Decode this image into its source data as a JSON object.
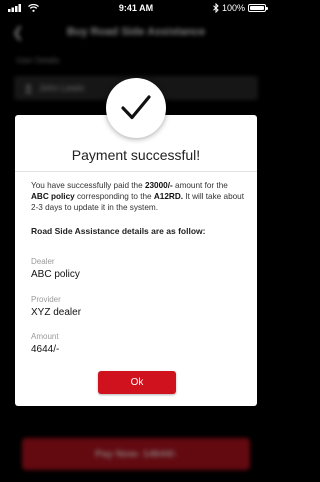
{
  "status_bar": {
    "time": "9:41 AM",
    "battery": "100%",
    "battery_level": 1.0
  },
  "background": {
    "nav_title": "Buy Road Side Assistance",
    "section_label": "User Details",
    "user_name": "John Lewis",
    "pay_button_label": "Pay Now- 14644/-"
  },
  "modal": {
    "title": "Payment successful!",
    "message": {
      "part1": "You have successfully paid the ",
      "amount": "23000/-",
      "part2": " amount for the ",
      "policy": "ABC policy",
      "part3": " corresponding to the ",
      "vehicle": "A12RD.",
      "part4": " It will take about 2-3 days to update it in the system."
    },
    "details_heading": "Road Side Assistance details are as follow:",
    "fields": [
      {
        "label": "Dealer",
        "value": "ABC policy"
      },
      {
        "label": "Provider",
        "value": "XYZ dealer"
      },
      {
        "label": "Amount",
        "value": "4644/-"
      }
    ],
    "ok_label": "Ok"
  },
  "colors": {
    "accent": "#d0121f",
    "overlay": "#000000",
    "modal_bg": "#ffffff"
  },
  "icons": {
    "success": "checkmark-icon",
    "back": "back-arrow-icon",
    "user": "user-icon"
  }
}
